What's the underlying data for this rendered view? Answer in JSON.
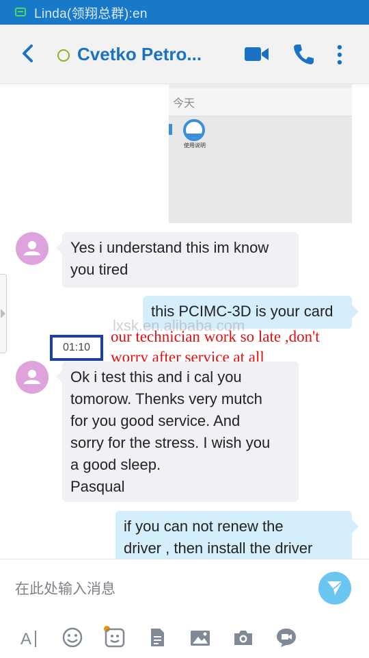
{
  "status_bar": {
    "text": "Linda(领翔总群):en",
    "notification_icon": "message-notification-icon"
  },
  "header": {
    "back_icon": "back-chevron-icon",
    "presence_icon": "presence-status-icon",
    "contact_name": "Cvetko Petro...",
    "video_call_icon": "video-call-icon",
    "voice_call_icon": "phone-icon",
    "more_icon": "more-vertical-icon",
    "accent_color": "#1a72c4"
  },
  "shared_image": {
    "date_label": "今天",
    "file_label": "使用说明"
  },
  "messages": [
    {
      "direction": "incoming",
      "text_lines": [
        "Yes i understand this im know",
        "you tired"
      ]
    },
    {
      "direction": "outgoing",
      "text_lines": [
        "this PCIMC-3D is your card"
      ]
    },
    {
      "direction": "incoming",
      "text_lines": [
        "Ok i test this and i cal you",
        "tomorow. Thenks very mutch",
        "for you good service. And",
        "sorry for the stress. I wish you",
        "a good sleep.",
        "Pasqual"
      ]
    },
    {
      "direction": "outgoing",
      "text_lines": [
        "if you can not renew the",
        "driver , then install the driver"
      ]
    }
  ],
  "timestamp": "01:10",
  "annotation": {
    "line1": "our technician work so late ,don't",
    "line2": "worry after service  at all",
    "color": "#e01010"
  },
  "watermark": "lxsk.en.alibaba.com",
  "composer": {
    "placeholder": "在此处输入消息",
    "send_icon": "send-icon"
  },
  "toolbar_icons": [
    "text-format-icon",
    "emoji-icon",
    "sticker-icon",
    "file-icon",
    "image-gallery-icon",
    "camera-icon",
    "video-message-icon"
  ]
}
